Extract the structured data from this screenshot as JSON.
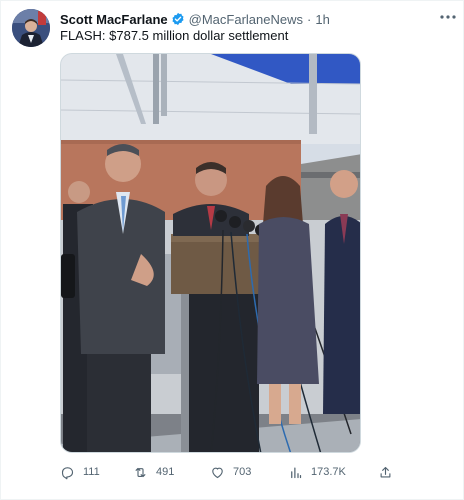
{
  "author": {
    "display_name": "Scott MacFarlane",
    "handle": "@MacFarlaneNews",
    "separator": "·",
    "time": "1h",
    "verified": true
  },
  "tweet": {
    "text": "FLASH:  $787.5 million dollar settlement"
  },
  "actions": {
    "replies": "111",
    "reposts": "491",
    "likes": "703",
    "views": "173.7K"
  },
  "colors": {
    "verified": "#1d9bf0",
    "muted_text": "#536471",
    "primary_text": "#0f1419",
    "border": "#cfd9de"
  },
  "icons": {
    "more": "more-horizontal-icon",
    "reply": "reply-icon",
    "repost": "repost-icon",
    "like": "heart-icon",
    "views": "bar-chart-icon",
    "share": "share-icon"
  }
}
